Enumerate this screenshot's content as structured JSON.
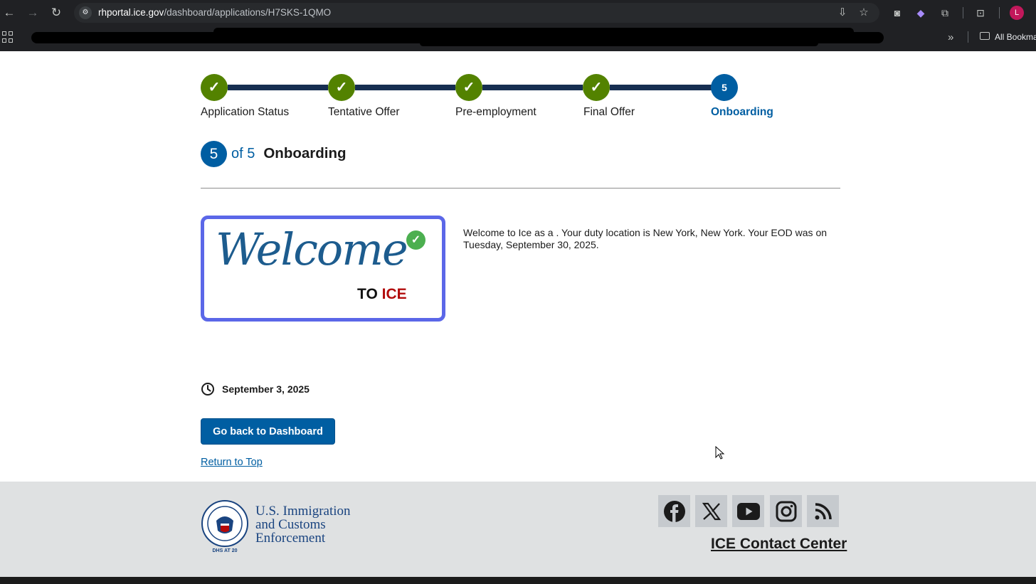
{
  "browser": {
    "url_host": "rhportal.ice.gov",
    "url_path": "/dashboard/applications/H7SKS-1QMO",
    "bookmarks_folder_label": "All Bookma",
    "profile_initial": "L"
  },
  "steps": [
    {
      "label": "Application Status",
      "state": "complete",
      "marker": "✓"
    },
    {
      "label": "Tentative Offer",
      "state": "complete",
      "marker": "✓"
    },
    {
      "label": "Pre-employment",
      "state": "complete",
      "marker": "✓"
    },
    {
      "label": "Final Offer",
      "state": "complete",
      "marker": "✓"
    },
    {
      "label": "Onboarding",
      "state": "current",
      "marker": "5"
    }
  ],
  "heading": {
    "number": "5",
    "of_text": "of 5",
    "title": "Onboarding"
  },
  "welcome_image": {
    "script_text": "Welcome",
    "to_text": "TO",
    "ice_text": "ICE"
  },
  "welcome_message": "Welcome to Ice as a . Your duty location is New York, New York. Your EOD was on Tuesday, September 30, 2025.",
  "date": "September 3, 2025",
  "buttons": {
    "dashboard": "Go back to Dashboard",
    "return_top": "Return to Top"
  },
  "footer": {
    "agency_lines": [
      "U.S. Immigration",
      "and Customs",
      "Enforcement"
    ],
    "seal_text": "DHS AT 20",
    "social": [
      "facebook-icon",
      "x-icon",
      "youtube-icon",
      "instagram-icon",
      "rss-icon"
    ],
    "contact_link": "ICE Contact Center"
  },
  "colors": {
    "step_complete": "#538200",
    "step_current": "#005ea2",
    "step_line": "#162e51",
    "primary": "#005ea2",
    "footer_bg": "#dfe1e2",
    "agency_text": "#1a4480"
  }
}
